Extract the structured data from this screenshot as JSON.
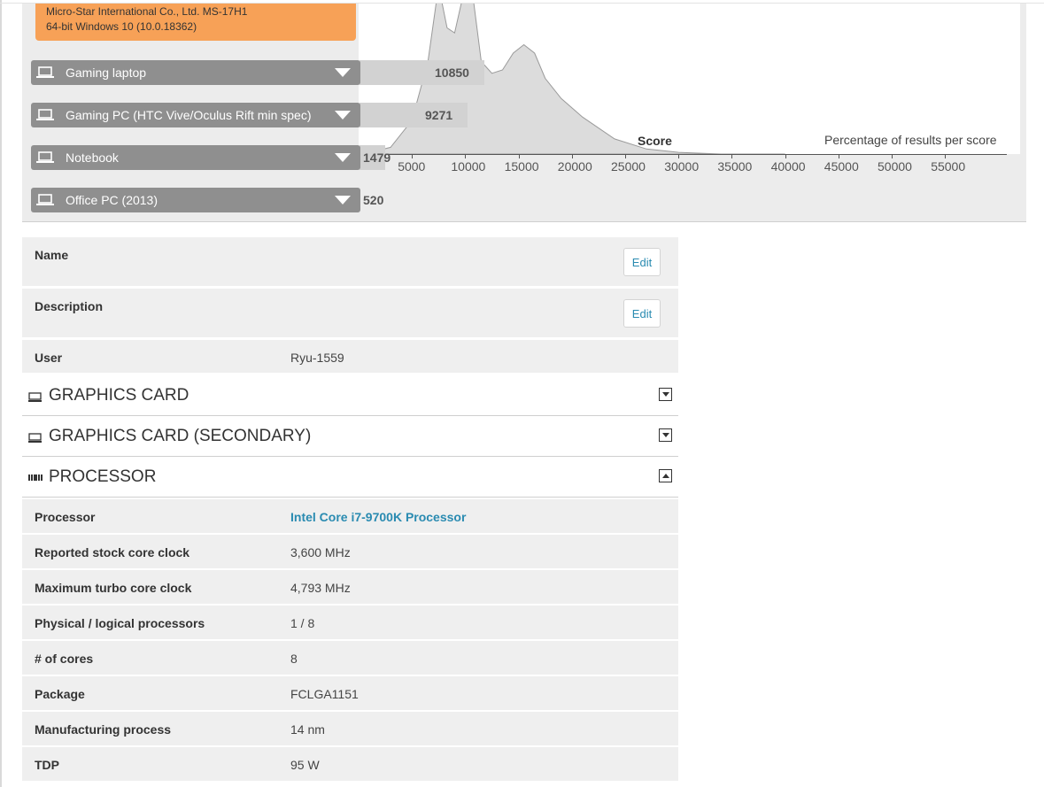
{
  "system": {
    "manufacturer": "Micro-Star International Co., Ltd. MS-17H1",
    "os": "64-bit Windows 10 (10.0.18362)"
  },
  "reference_bars": [
    {
      "label": "Gaming laptop",
      "score": "10850",
      "icon": "laptop-icon"
    },
    {
      "label": "Gaming PC (HTC Vive/Oculus Rift min spec)",
      "score": "9271",
      "icon": "laptop-icon"
    },
    {
      "label": "Notebook",
      "score": "1479",
      "icon": "laptop-icon"
    },
    {
      "label": "Office PC (2013)",
      "score": "520",
      "icon": "laptop-icon"
    }
  ],
  "chart_data": {
    "type": "area",
    "xlabel": "Score",
    "ylabel": "Percentage of results per score",
    "x_ticks": [
      "5000",
      "10000",
      "15000",
      "20000",
      "25000",
      "30000",
      "35000",
      "40000",
      "45000",
      "50000",
      "55000"
    ],
    "xlim": [
      0,
      60000
    ],
    "fill_color": "#dcdcdc",
    "curve": {
      "x": [
        500,
        3000,
        5000,
        6500,
        7500,
        8300,
        9000,
        10000,
        10800,
        11500,
        12500,
        13500,
        14500,
        15500,
        16500,
        17500,
        19000,
        21000,
        24000,
        27000,
        30000,
        34000,
        40000
      ],
      "y": [
        0.0,
        0.04,
        0.2,
        0.55,
        1.0,
        0.75,
        0.72,
        1.0,
        0.9,
        0.55,
        0.48,
        0.5,
        0.6,
        0.65,
        0.6,
        0.45,
        0.33,
        0.22,
        0.09,
        0.03,
        0.01,
        0.0,
        0.0
      ]
    }
  },
  "info_rows": [
    {
      "key": "Name",
      "value": "",
      "edit": "Edit"
    },
    {
      "key": "Description",
      "value": "",
      "edit": "Edit"
    },
    {
      "key": "User",
      "value": "Ryu-1559"
    }
  ],
  "sections": [
    {
      "title": "GRAPHICS CARD",
      "icon": "monitor-icon",
      "state": "collapsed"
    },
    {
      "title": "GRAPHICS CARD (SECONDARY)",
      "icon": "monitor-icon",
      "state": "collapsed"
    },
    {
      "title": "PROCESSOR",
      "icon": "cpu-icon",
      "state": "expanded"
    }
  ],
  "processor_rows": [
    {
      "key": "Processor",
      "value": "Intel Core i7-9700K Processor",
      "link": true
    },
    {
      "key": "Reported stock core clock",
      "value": "3,600 MHz"
    },
    {
      "key": "Maximum turbo core clock",
      "value": "4,793 MHz"
    },
    {
      "key": "Physical / logical processors",
      "value": "1 / 8"
    },
    {
      "key": "# of cores",
      "value": "8"
    },
    {
      "key": "Package",
      "value": "FCLGA1151"
    },
    {
      "key": "Manufacturing process",
      "value": "14 nm"
    },
    {
      "key": "TDP",
      "value": "95 W"
    }
  ],
  "colors": {
    "accent_link": "#2a8bb1",
    "system_box": "#f7a157",
    "bar": "#8f8f8f"
  }
}
